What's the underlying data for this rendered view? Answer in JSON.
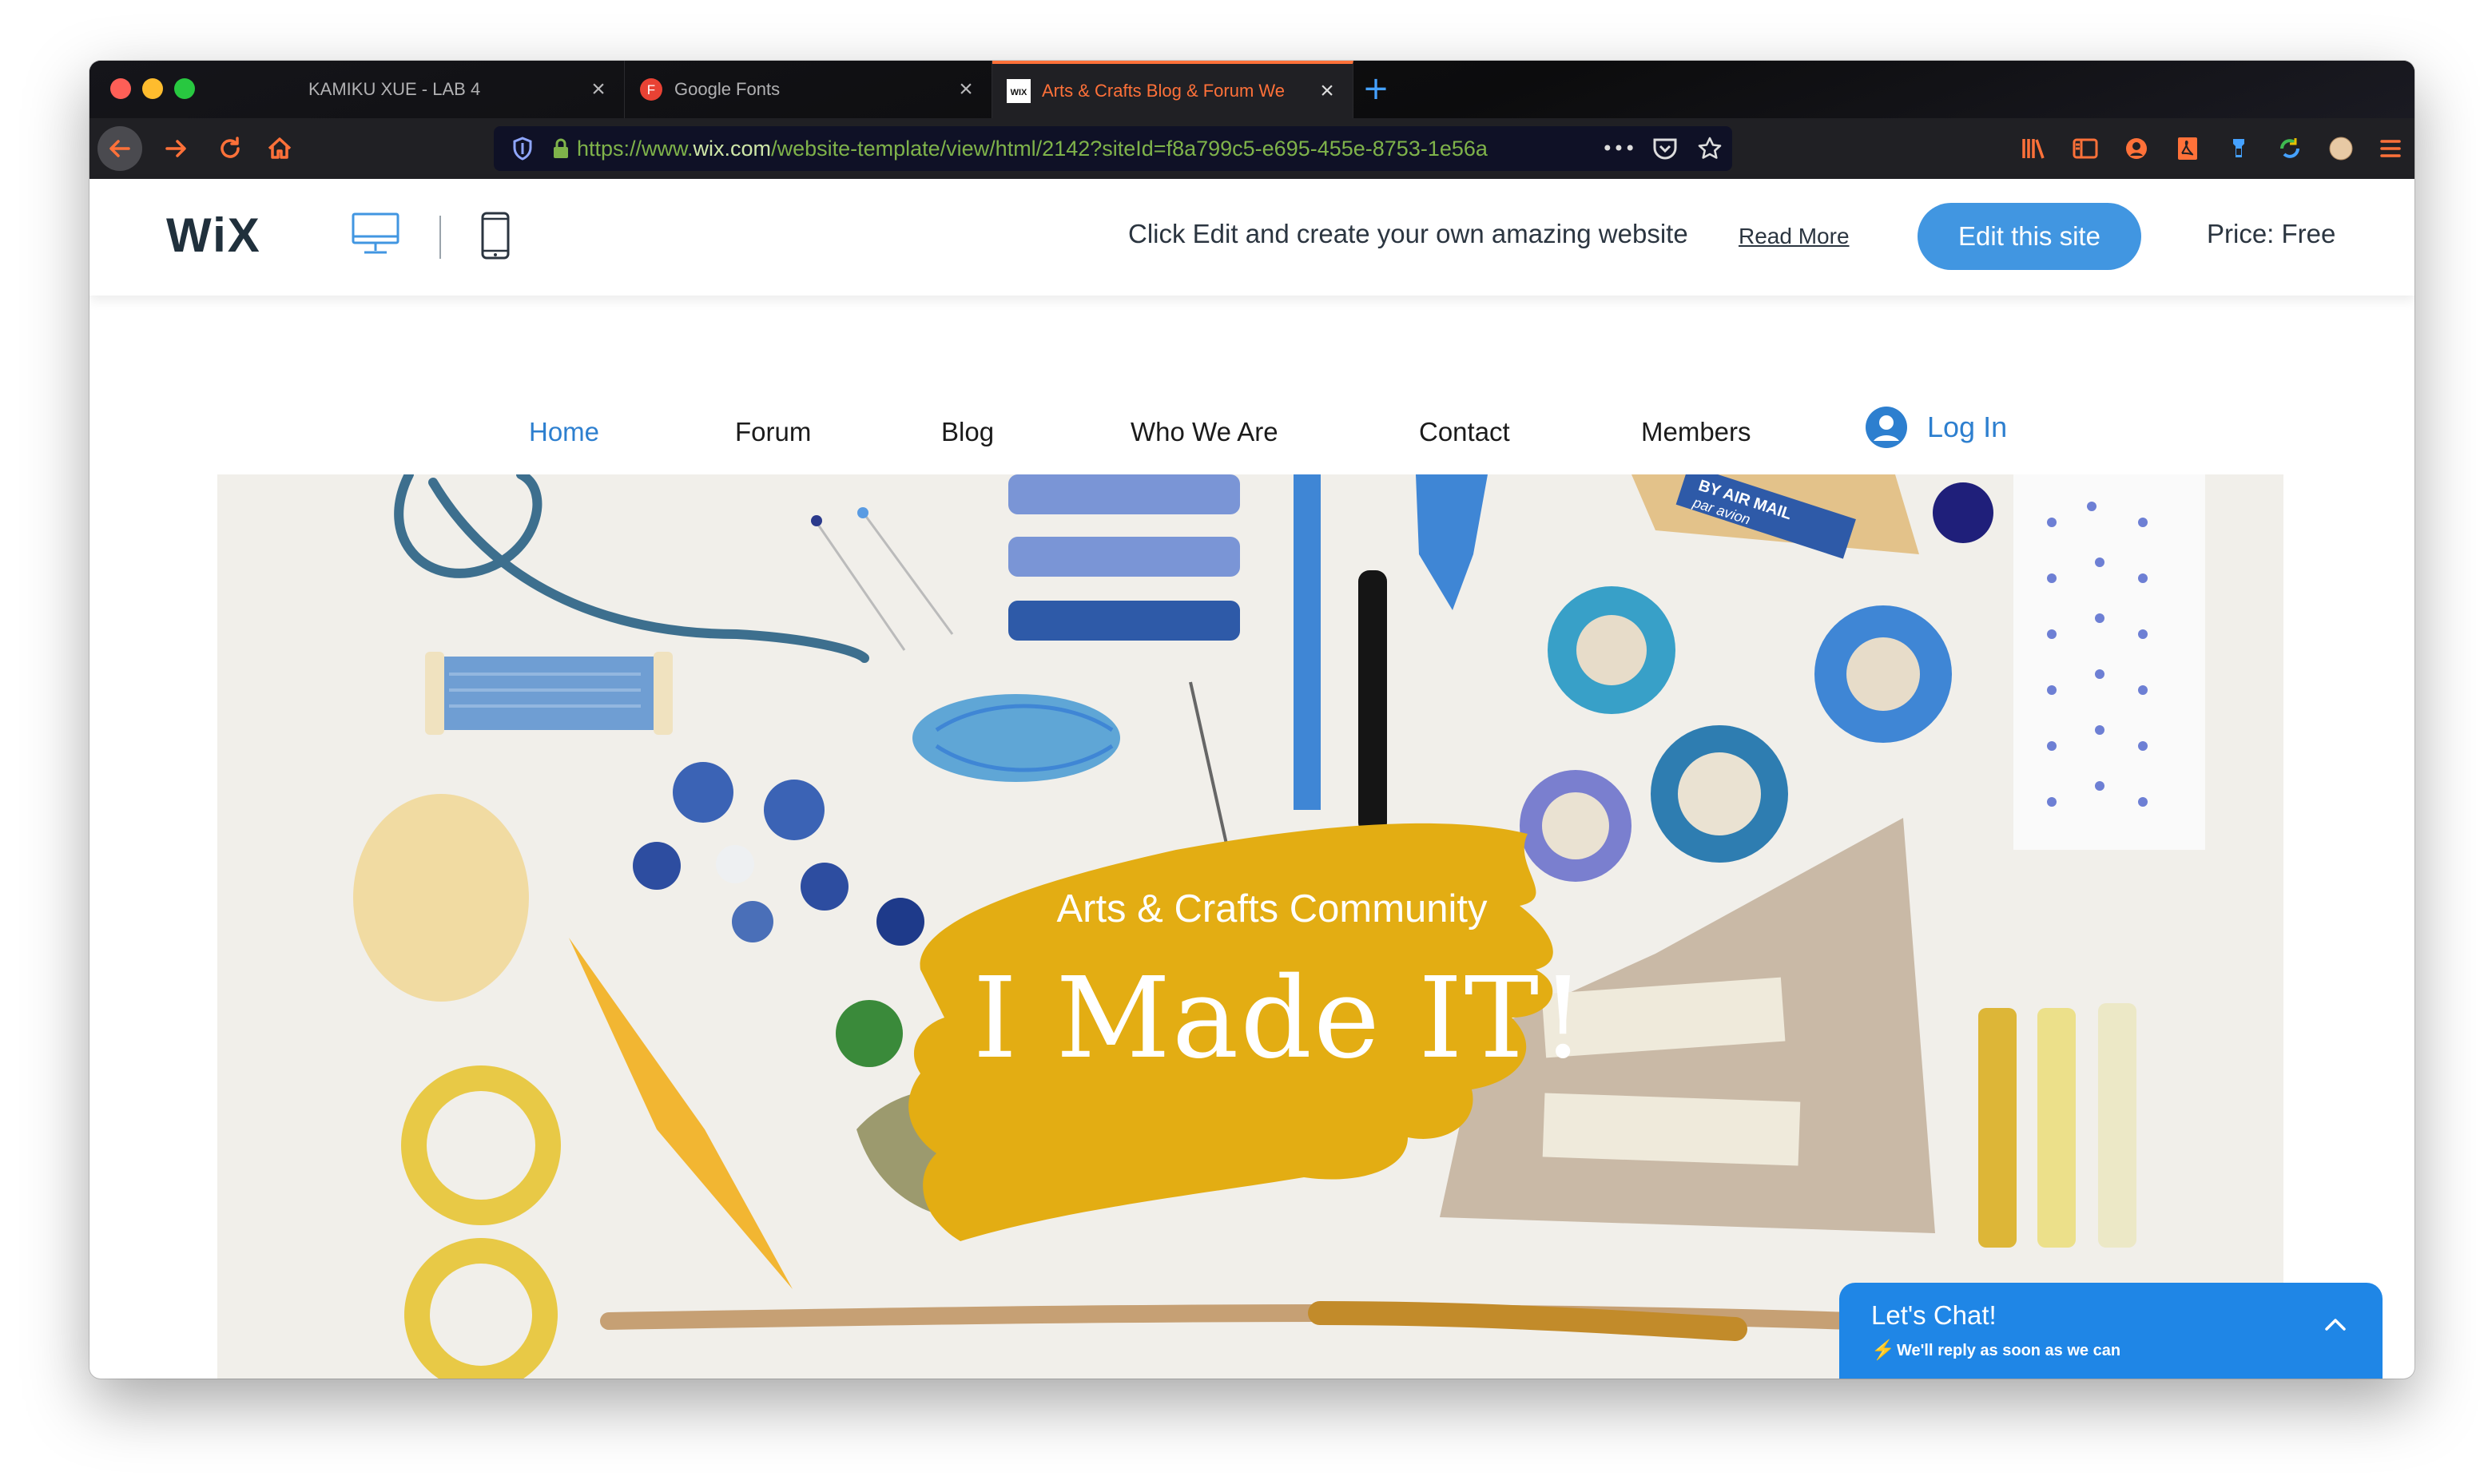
{
  "browser": {
    "tabs": [
      {
        "label": "KAMIKU XUE - LAB 4",
        "favicon": "page-icon",
        "active": false
      },
      {
        "label": "Google Fonts",
        "favicon": "google-fonts-icon",
        "favicon_letter": "F",
        "active": false
      },
      {
        "label": "Arts & Crafts Blog & Forum We",
        "favicon": "wix-icon",
        "favicon_text": "WIX",
        "active": true
      }
    ],
    "new_tab": "+",
    "url_prefix": "https://www.",
    "url_domain": "wix.com",
    "url_rest": "/website-template/view/html/2142?siteId=f8a799c5-e695-455e-8753-1e56a",
    "more_label": "•••",
    "accent_color": "#ff7139"
  },
  "wix_header": {
    "logo": "WiX",
    "tagline": "Click Edit and create your own amazing website",
    "read_more": "Read More",
    "edit_button": "Edit this site",
    "price": "Price: Free",
    "button_color": "#4196e1"
  },
  "site_nav": {
    "items": [
      {
        "label": "Home",
        "active": true
      },
      {
        "label": "Forum",
        "active": false
      },
      {
        "label": "Blog",
        "active": false
      },
      {
        "label": "Who We Are",
        "active": false
      },
      {
        "label": "Contact",
        "active": false
      },
      {
        "label": "Members",
        "active": false
      }
    ],
    "login": "Log In",
    "active_color": "#2d7fcf"
  },
  "hero": {
    "subtitle": "Arts & Crafts Community",
    "headline": "I Made IT!",
    "airmail_line1": "BY AIR MAIL",
    "airmail_line2": "par avion",
    "brush_color": "#e3ad13"
  },
  "chat": {
    "title": "Let's Chat!",
    "subtitle": "We'll reply as soon as we can",
    "color": "#1f86e6"
  }
}
